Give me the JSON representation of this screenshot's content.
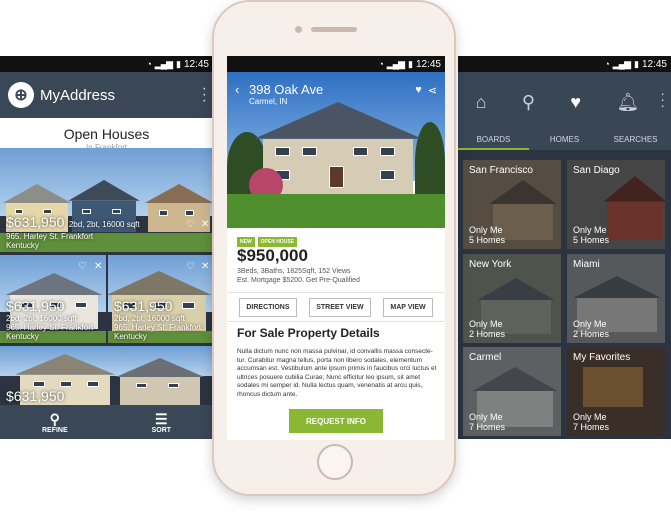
{
  "status": {
    "time": "12:45",
    "icons": "wifi-signal-battery"
  },
  "left_phone": {
    "app_title": "MyAddress",
    "list_title": "Open Houses",
    "list_subtitle": "In Frankfort",
    "listings": [
      {
        "price": "$631,950",
        "specs": "2bd, 2bt, 16000 sqft",
        "address": "965. Harley St. Frankfort",
        "state": "Kentucky"
      },
      {
        "price": "$631,950",
        "specs": "2bd, 2bt, 16000 sqft",
        "address": "965. Harley St. Frankfort",
        "state": "Kentucky"
      },
      {
        "price": "$631,950",
        "specs": "2bd, 2bt, 16000 sqft",
        "address": "965. Harley St. Frankfort",
        "state": "Kentucky"
      },
      {
        "price": "$631,950",
        "specs": "",
        "address": "",
        "state": ""
      }
    ],
    "bottom_bar": {
      "refine": "REFINE",
      "sort": "SORT"
    }
  },
  "center_phone": {
    "address": "398 Oak Ave",
    "city": "Carmel, IN",
    "badges": [
      "NEW",
      "OPEN HOUSE"
    ],
    "price": "$950,000",
    "details": "3Beds, 3Baths, 1825Sqft, 152 Views",
    "mortgage": "Est. Mortgage $5200. Get Pre-Qualified",
    "actions": {
      "directions": "DIRECTIONS",
      "street_view": "STREET VIEW",
      "map_view": "MAP VIEW"
    },
    "section_title": "For Sale Property Details",
    "description": "Nulla dictum nunc non massa pulvinar, id convallis massa consecte-tur. Curabitur magna tellus, porta non libero sodales, elementum accumsan est. Vestibulum ante ipsum primis in faucibus orci luctus et ultrices posuere cubilia Curae; Nunc efficitur leo ipsum, sit amet sodales mi semper id. Nulla lectus quam, venenatis at arcu quis, rhoncus dictum ante.",
    "request_button": "REQUEST INFO"
  },
  "right_phone": {
    "tabs": [
      "BOARDS",
      "HOMES",
      "SEARCHES"
    ],
    "active_tab": "BOARDS",
    "boards": [
      {
        "name": "San Francisco",
        "line1": "Only Me",
        "line2": "5 Homes"
      },
      {
        "name": "San Diago",
        "line1": "Only Me",
        "line2": "5 Homes"
      },
      {
        "name": "New York",
        "line1": "Only Me",
        "line2": "2 Homes"
      },
      {
        "name": "Miami",
        "line1": "Only Me",
        "line2": "2 Homes"
      },
      {
        "name": "Carmel",
        "line1": "Only Me",
        "line2": "7 Homes"
      },
      {
        "name": "My Favorites",
        "line1": "Only Me",
        "line2": "7 Homes"
      }
    ]
  },
  "colors": {
    "accent": "#8ab833",
    "appbar": "#3a4756",
    "dark": "#2b3440"
  }
}
